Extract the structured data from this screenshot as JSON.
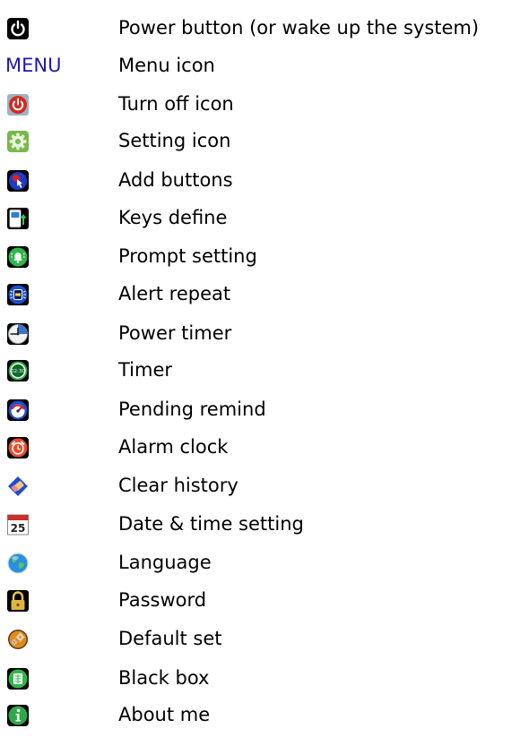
{
  "items": [
    {
      "icon": "power-symbol-icon",
      "label": "Power button (or wake up the system)"
    },
    {
      "icon": "menu-text-icon",
      "icon_text": "MENU",
      "label": "Menu icon"
    },
    {
      "icon": "turn-off-icon",
      "label": "Turn off icon"
    },
    {
      "icon": "gear-icon",
      "label": "Setting icon"
    },
    {
      "icon": "add-buttons-icon",
      "label": "Add buttons"
    },
    {
      "icon": "keys-define-icon",
      "label": "Keys define"
    },
    {
      "icon": "bell-icon",
      "label": "Prompt setting"
    },
    {
      "icon": "alert-repeat-icon",
      "label": "Alert repeat"
    },
    {
      "icon": "clock-icon",
      "label": "Power timer"
    },
    {
      "icon": "timer-icon",
      "icon_text": "02:30",
      "label": "Timer"
    },
    {
      "icon": "gauge-icon",
      "label": "Pending remind"
    },
    {
      "icon": "alarm-clock-icon",
      "label": "Alarm clock"
    },
    {
      "icon": "eraser-icon",
      "label": "Clear history"
    },
    {
      "icon": "calendar-icon",
      "icon_text": "25",
      "label": "Date & time setting"
    },
    {
      "icon": "globe-icon",
      "label": "Language"
    },
    {
      "icon": "padlock-icon",
      "label": "Password"
    },
    {
      "icon": "gears-icon",
      "label": "Default set"
    },
    {
      "icon": "black-box-icon",
      "label": "Black box"
    },
    {
      "icon": "info-icon",
      "label": "About me"
    }
  ],
  "colors": {
    "menu_text": "#1f1aa8",
    "text": "#000000",
    "background": "#ffffff"
  }
}
